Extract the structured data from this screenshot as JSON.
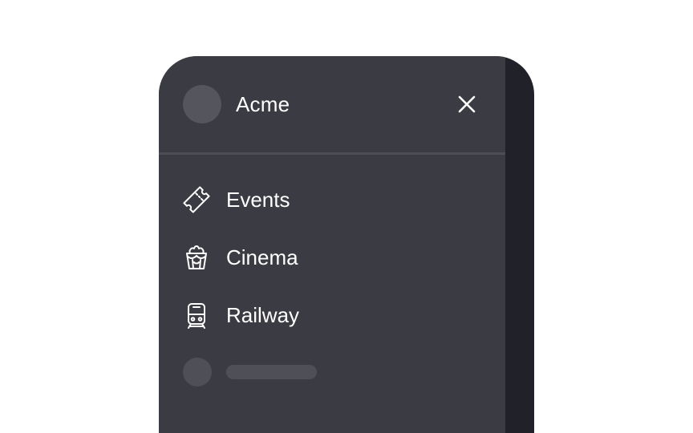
{
  "brand": {
    "name": "Acme",
    "avatar_color": "#55555d"
  },
  "header": {
    "close_icon": "close-icon"
  },
  "nav": {
    "items": [
      {
        "label": "Events",
        "icon": "ticket-icon"
      },
      {
        "label": "Cinema",
        "icon": "popcorn-icon"
      },
      {
        "label": "Railway",
        "icon": "train-icon"
      }
    ]
  },
  "colors": {
    "drawer_bg": "#3b3b43",
    "drawer_edge": "#212129",
    "divider": "#4d4d56",
    "text": "#ffffff",
    "skeleton": "#4f4f57"
  }
}
